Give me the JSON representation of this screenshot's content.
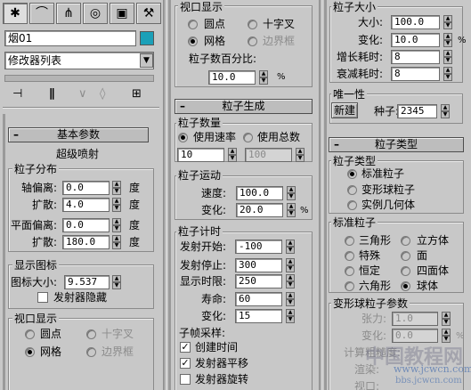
{
  "left": {
    "tab_icons": [
      "create-icon",
      "modify-icon",
      "hierarchy-icon",
      "motion-icon",
      "display-icon",
      "utilities-icon"
    ],
    "object_name": "烟01",
    "modifier_list": "修改器列表",
    "basic_params_title": "基本参数",
    "super_spray": "超级喷射",
    "dist_group": "粒子分布",
    "axis_offset_label": "轴偏离:",
    "axis_offset_value": "0.0",
    "spread1_label": "扩散:",
    "spread1_value": "4.0",
    "plane_offset_label": "平面偏离:",
    "plane_offset_value": "0.0",
    "spread2_label": "扩散:",
    "spread2_value": "180.0",
    "deg": "度",
    "display_icon_group": "显示图标",
    "icon_size_label": "图标大小:",
    "icon_size_value": "9.537",
    "emitter_hidden": "发射器隐藏",
    "viewport_group": "视口显示",
    "dots": "圆点",
    "ticks": "十字叉",
    "mesh": "网格",
    "bbox": "边界框"
  },
  "middle": {
    "viewport_group": "视口显示",
    "dots": "圆点",
    "ticks": "十字叉",
    "mesh": "网格",
    "bbox": "边界框",
    "percent_label": "粒子数百分比:",
    "percent_value": "10.0",
    "percent_unit": "%",
    "gen_title": "粒子生成",
    "qty_group": "粒子数量",
    "use_rate": "使用速率",
    "use_total": "使用总数",
    "rate_value": "10",
    "total_value": "100",
    "motion_group": "粒子运动",
    "speed_label": "速度:",
    "speed_value": "100.0",
    "variation_label": "变化:",
    "variation_value": "20.0",
    "variation_unit": "%",
    "timing_group": "粒子计时",
    "emit_start_label": "发射开始:",
    "emit_start_value": "-100",
    "emit_stop_label": "发射停止:",
    "emit_stop_value": "300",
    "display_until_label": "显示时限:",
    "display_until_value": "250",
    "life_label": "寿命:",
    "life_value": "60",
    "life_var_label": "变化:",
    "life_var_value": "15",
    "subframe_label": "子帧采样:",
    "creation_time": "创建时间",
    "emitter_translation": "发射器平移",
    "emitter_rotation": "发射器旋转"
  },
  "right": {
    "size_group": "粒子大小",
    "size_label": "大小:",
    "size_value": "100.0",
    "size_var_label": "变化:",
    "size_var_value": "10.0",
    "size_var_unit": "%",
    "grow_label": "增长耗时:",
    "grow_value": "8",
    "fade_label": "衰减耗时:",
    "fade_value": "8",
    "unique_group": "唯一性",
    "new_button": "新建",
    "seed_label": "种子:",
    "seed_value": "2345",
    "type_title": "粒子类型",
    "type_group": "粒子类型",
    "standard": "标准粒子",
    "metaparticles": "变形球粒子",
    "instanced": "实例几何体",
    "std_group": "标准粒子",
    "triangle": "三角形",
    "cube": "立方体",
    "special": "特殊",
    "facing": "面",
    "constant": "恒定",
    "tetra": "四面体",
    "sixpoint": "六角形",
    "sphere": "球体",
    "meta_group": "变形球粒子参数",
    "tension_label": "张力:",
    "tension_value": "1.0",
    "meta_var_label": "变化:",
    "meta_var_value": "0.0",
    "meta_var_unit": "%",
    "calc_label": "计算粗糙度:",
    "render_label": "渲染:",
    "viewport_label": "视口:"
  },
  "watermark": {
    "main": "中国教程网",
    "url": "www.jcwcn.com",
    "forum": "bbs.jcwcn.com"
  },
  "colors": {
    "panel_bg": "#c8c8c8",
    "object_color_swatch": "#1ba0b8"
  }
}
